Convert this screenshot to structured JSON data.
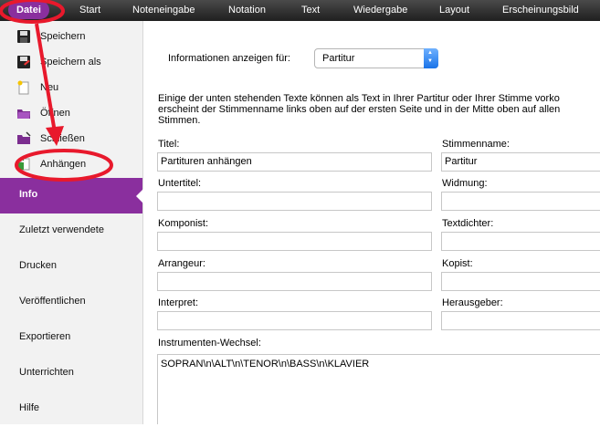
{
  "menubar": {
    "items": [
      "Datei",
      "Start",
      "Noteneingabe",
      "Notation",
      "Text",
      "Wiedergabe",
      "Layout",
      "Erscheinungsbild"
    ]
  },
  "sidebar": {
    "file_items": [
      {
        "label": "Speichern",
        "icon": "floppy-disk-icon"
      },
      {
        "label": "Speichern als",
        "icon": "floppy-disk-pencil-icon"
      },
      {
        "label": "Neu",
        "icon": "new-document-icon"
      },
      {
        "label": "Öffnen",
        "icon": "folder-open-icon"
      },
      {
        "label": "Schließen",
        "icon": "folder-close-icon"
      },
      {
        "label": "Anhängen",
        "icon": "append-icon"
      }
    ],
    "categories": [
      "Info",
      "Zuletzt verwendete",
      "Drucken",
      "Veröffentlichen",
      "Exportieren",
      "Unterrichten",
      "Hilfe"
    ],
    "active_category": "Info"
  },
  "info": {
    "show_for_label": "Informationen anzeigen für:",
    "show_for_value": "Partitur",
    "description_lines": [
      "Einige der unten stehenden Texte können als Text in Ihrer Partitur oder Ihrer Stimme vorko",
      "erscheint der Stimmenname links oben auf der ersten Seite und in der Mitte oben auf allen",
      "Stimmen."
    ],
    "fields": {
      "title_label": "Titel:",
      "title_value": "Partituren anhängen",
      "partname_label": "Stimmenname:",
      "partname_value": "Partitur",
      "subtitle_label": "Untertitel:",
      "subtitle_value": "",
      "dedication_label": "Widmung:",
      "dedication_value": "",
      "composer_label": "Komponist:",
      "composer_value": "",
      "lyricist_label": "Textdichter:",
      "lyricist_value": "",
      "arranger_label": "Arrangeur:",
      "arranger_value": "",
      "copyist_label": "Kopist:",
      "copyist_value": "",
      "artist_label": "Interpret:",
      "artist_value": "",
      "publisher_label": "Herausgeber:",
      "publisher_value": "",
      "instrument_change_label": "Instrumenten-Wechsel:",
      "instrument_change_value": "SOPRAN\\n\\ALT\\n\\TENOR\\n\\BASS\\n\\KLAVIER"
    }
  },
  "colors": {
    "accent": "#8a2f9e",
    "annotation": "#e8192c",
    "select_arrow": "#1a73e8"
  }
}
